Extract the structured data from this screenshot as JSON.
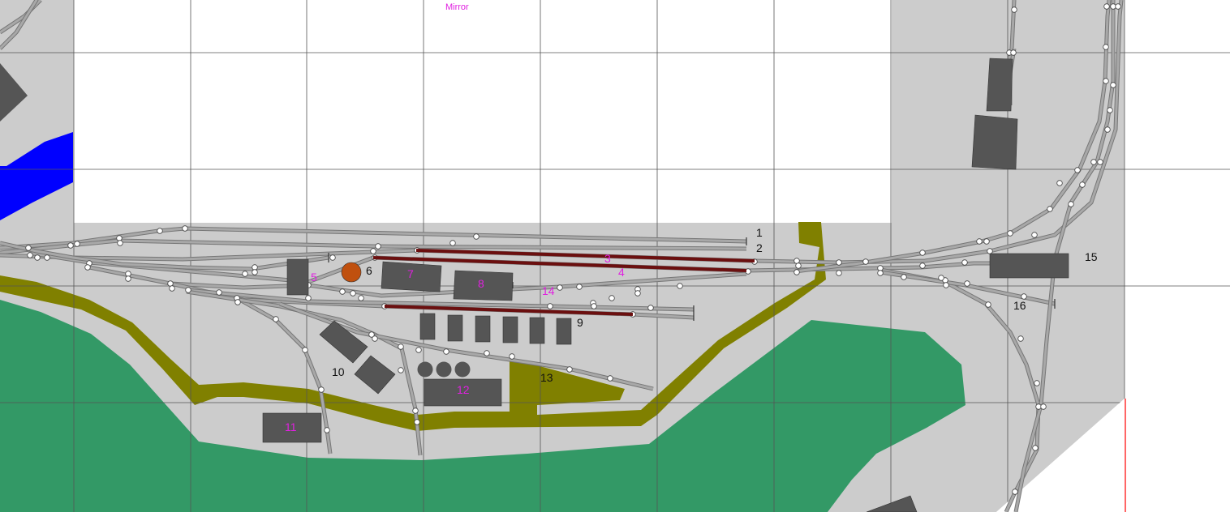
{
  "title": "Mirror",
  "colors": {
    "base": "#cccccc",
    "grid": "#555555",
    "water": "#0000ff",
    "green": "#339966",
    "road": "#808000",
    "building": "#555555",
    "track": "#a8a8a8",
    "rail": "#777777",
    "highlight": "#6b0f0f",
    "tank": "#c0500e",
    "magenta_label": "#e020e0",
    "black_label": "#111111",
    "edge_line": "#ff0000"
  },
  "labels": {
    "l1": "1",
    "l2": "2",
    "l3": "3",
    "l4": "4",
    "l5": "5",
    "l6": "6",
    "l7": "7",
    "l8": "8",
    "l9": "9",
    "l10": "10",
    "l11": "11",
    "l12": "12",
    "l13": "13",
    "l14": "14",
    "l15": "15",
    "l16": "16"
  }
}
